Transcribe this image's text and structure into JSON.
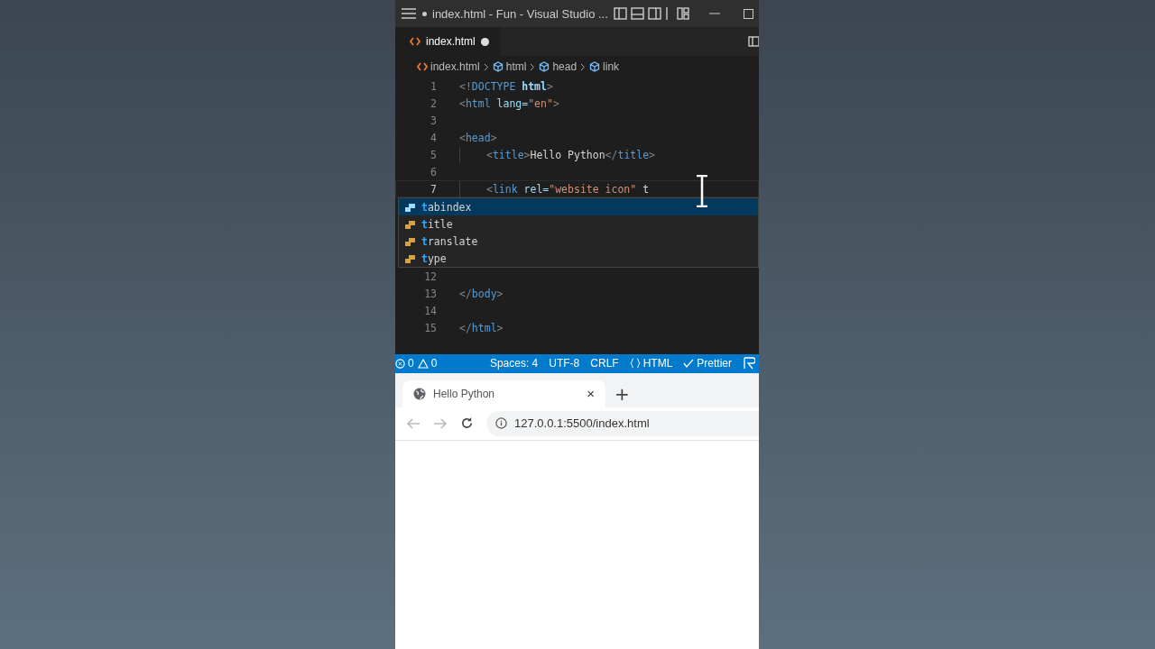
{
  "window": {
    "title": "index.html - Fun - Visual Studio ...",
    "modified": true
  },
  "tabs": [
    {
      "label": "index.html",
      "selected": true,
      "modified": true
    }
  ],
  "breadcrumbs": [
    "index.html",
    "html",
    "head",
    "link"
  ],
  "code_before": [
    {
      "number": "1",
      "tokens": [
        {
          "text": "<!",
          "kind": "punct"
        },
        {
          "text": "DOCTYPE",
          "kind": "tag"
        },
        {
          "text": " html",
          "kind": "keyword"
        },
        {
          "text": ">",
          "kind": "punct"
        }
      ]
    },
    {
      "number": "2",
      "tokens": [
        {
          "text": "<",
          "kind": "punct"
        },
        {
          "text": "html",
          "kind": "tag"
        },
        {
          "text": " lang=",
          "kind": "attr"
        },
        {
          "text": "\"en\"",
          "kind": "string"
        },
        {
          "text": ">",
          "kind": "punct"
        }
      ]
    },
    {
      "number": "3"
    },
    {
      "number": "4",
      "tokens": [
        {
          "text": "<",
          "kind": "punct"
        },
        {
          "text": "head",
          "kind": "tag"
        },
        {
          "text": ">",
          "kind": "punct"
        }
      ]
    },
    {
      "number": "5",
      "indent": true,
      "tokens": [
        {
          "text": "<",
          "kind": "punct"
        },
        {
          "text": "title",
          "kind": "tag"
        },
        {
          "text": ">",
          "kind": "punct"
        },
        {
          "text": "Hello Python",
          "kind": "text"
        },
        {
          "text": "</",
          "kind": "punct"
        },
        {
          "text": "title",
          "kind": "tag"
        },
        {
          "text": ">",
          "kind": "punct"
        }
      ]
    },
    {
      "number": "6"
    },
    {
      "number": "7",
      "indent": true,
      "current": true,
      "tokens": [
        {
          "text": "<",
          "kind": "punct"
        },
        {
          "text": "link",
          "kind": "tag"
        },
        {
          "text": " rel=",
          "kind": "attr"
        },
        {
          "text": "\"website icon\"",
          "kind": "string"
        },
        {
          "text": " t",
          "kind": "text"
        }
      ]
    }
  ],
  "suggestions": [
    {
      "match": "t",
      "rest": "abindex",
      "selected": true
    },
    {
      "match": "t",
      "rest": "itle",
      "selected": false
    },
    {
      "match": "t",
      "rest": "ranslate",
      "selected": false
    },
    {
      "match": "t",
      "rest": "ype",
      "selected": false
    }
  ],
  "code_after": [
    {
      "number": "12"
    },
    {
      "number": "13",
      "tokens": [
        {
          "text": "</",
          "kind": "punct"
        },
        {
          "text": "body",
          "kind": "tag"
        },
        {
          "text": ">",
          "kind": "punct"
        }
      ]
    },
    {
      "number": "14"
    },
    {
      "number": "15",
      "tokens": [
        {
          "text": "</",
          "kind": "punct"
        },
        {
          "text": "html",
          "kind": "tag"
        },
        {
          "text": ">",
          "kind": "punct"
        }
      ]
    }
  ],
  "status_bar": {
    "errors": "0",
    "warnings": "0",
    "items": [
      "Spaces: 4",
      "UTF-8",
      "CRLF",
      "HTML",
      "Prettier"
    ]
  },
  "browser": {
    "tab": {
      "title": "Hello Python",
      "close": "×",
      "selected": true
    },
    "new_tab": "+",
    "url": "127.0.0.1:5500/index.html"
  }
}
